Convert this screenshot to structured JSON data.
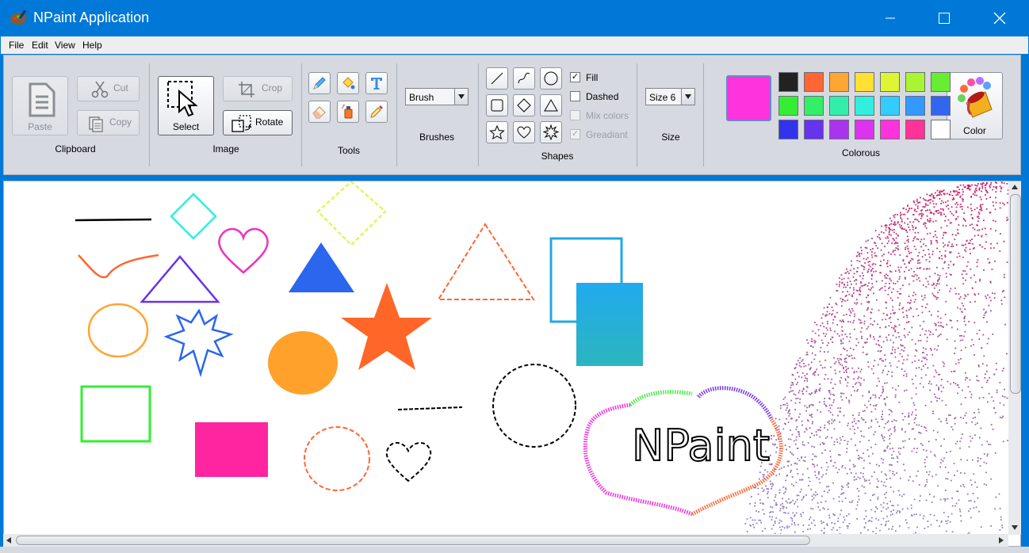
{
  "window": {
    "title": "NPaint Application"
  },
  "menu": [
    "File",
    "Edit",
    "View",
    "Help"
  ],
  "clipboard": {
    "paste": "Paste",
    "cut": "Cut",
    "copy": "Copy",
    "label": "Clipboard"
  },
  "image": {
    "select": "Select",
    "crop": "Crop",
    "rotate": "Rotate",
    "label": "Image"
  },
  "tools": {
    "label": "Tools"
  },
  "brushes": {
    "selected": "Brush",
    "label": "Brushes"
  },
  "shapes": {
    "label": "Shapes",
    "fill": "Fill",
    "dashed": "Dashed",
    "mix_colors": "Mix colors",
    "gradient": "Greadiant"
  },
  "size": {
    "selected": "Size 6",
    "label": "Size"
  },
  "colours": {
    "label": "Colorous",
    "color_button": "Color",
    "current": "#ff33dd",
    "palette": [
      "#222222",
      "#ff6633",
      "#ffa533",
      "#ffe033",
      "#ddf533",
      "#aaf533",
      "#66ee33",
      "#33ee33",
      "#33ee66",
      "#33eeaa",
      "#33eedd",
      "#33ccff",
      "#3399ff",
      "#3366ee",
      "#3333ee",
      "#6633ee",
      "#aa33ee",
      "#dd33ee",
      "#ff33dd",
      "#ff3399",
      "#ffffff"
    ]
  },
  "canvas": {
    "text": "NPaint"
  }
}
